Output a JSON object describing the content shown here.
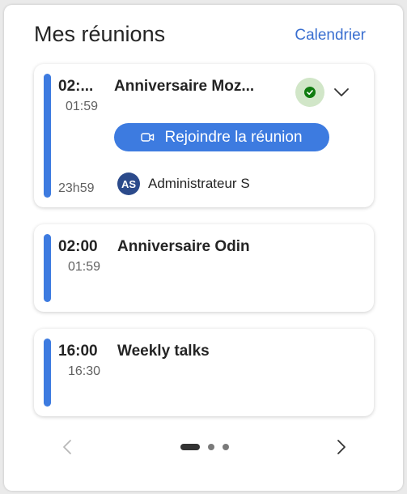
{
  "colors": {
    "accent": "#3d7be0",
    "link": "#3a6fd0",
    "status_bg": "#d1e6c8",
    "status_dot": "#107c10",
    "avatar_bg": "#2b4a8b",
    "dot_active": "#333333",
    "dot_inactive": "#7a7a7a",
    "prev_disabled": "#b8b8b8",
    "next_enabled": "#333333"
  },
  "header": {
    "title": "Mes réunions",
    "calendar_link": "Calendrier"
  },
  "meetings": [
    {
      "start": "02:...",
      "end": "01:59",
      "title": "Anniversaire Moz...",
      "status_icon": "checkmark-icon",
      "join_label": "Rejoindre la réunion",
      "duration": "23h59",
      "organizer_initials": "AS",
      "organizer_name": "Administrateur S"
    },
    {
      "start": "02:00",
      "end": "01:59",
      "title": "Anniversaire Odin"
    },
    {
      "start": "16:00",
      "end": "16:30",
      "title": "Weekly talks"
    }
  ],
  "pagination": {
    "pages": 3,
    "current": 1,
    "prev_icon": "chevron-left-icon",
    "next_icon": "chevron-right-icon"
  }
}
